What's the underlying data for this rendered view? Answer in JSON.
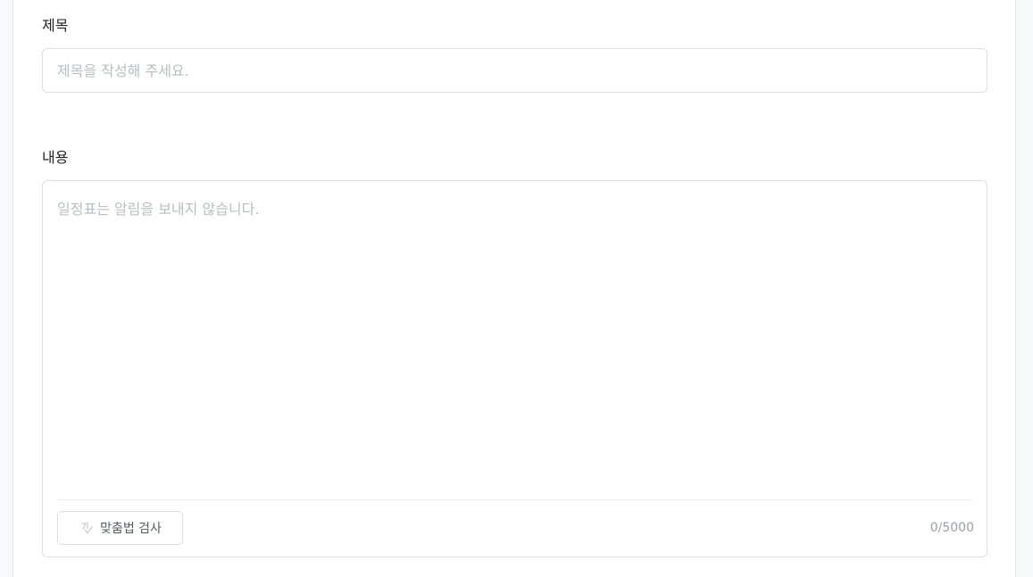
{
  "form": {
    "title_label": "제목",
    "title_placeholder": "제목을 작성해 주세요.",
    "title_value": "",
    "content_label": "내용",
    "content_placeholder": "일정표는 알림을 보내지 않습니다.",
    "content_value": "",
    "spell_check_label": "맞춤법 검사",
    "char_count": "0",
    "char_limit": "5000"
  },
  "icons": {
    "spell_check": "spell-check-icon"
  },
  "colors": {
    "border": "#dcdfe3",
    "placeholder": "#b9bdc3",
    "counter": "#9aa0a6",
    "background": "#f8f9fb"
  }
}
